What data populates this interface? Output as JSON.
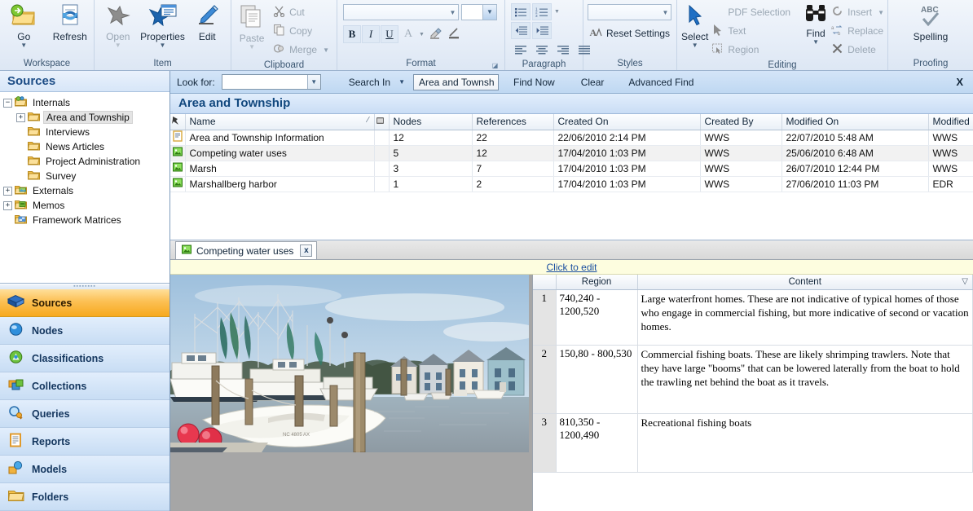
{
  "ribbon": {
    "groups": [
      {
        "name": "Workspace",
        "label": "Workspace",
        "buttons": [
          {
            "label": "Go",
            "icon": "folder-go-icon",
            "caret": true,
            "disabled": false
          },
          {
            "label": "Refresh",
            "icon": "refresh-icon",
            "caret": false,
            "disabled": false
          }
        ]
      },
      {
        "name": "Item",
        "label": "Item",
        "buttons": [
          {
            "label": "Open",
            "icon": "open-item-icon",
            "caret": true,
            "disabled": true
          },
          {
            "label": "Properties",
            "icon": "properties-icon",
            "caret": true,
            "disabled": false
          },
          {
            "label": "Edit",
            "icon": "edit-pencil-icon",
            "caret": false,
            "disabled": false
          }
        ]
      },
      {
        "name": "Clipboard",
        "label": "Clipboard",
        "big": {
          "label": "Paste",
          "icon": "paste-icon",
          "caret": true,
          "disabled": true
        },
        "items": [
          {
            "label": "Cut",
            "icon": "scissors-icon",
            "disabled": true
          },
          {
            "label": "Copy",
            "icon": "copy-icon",
            "disabled": true
          },
          {
            "label": "Merge",
            "icon": "merge-icon",
            "disabled": true,
            "caret": true
          }
        ]
      },
      {
        "name": "Format",
        "label": "Format"
      },
      {
        "name": "Paragraph",
        "label": "Paragraph"
      },
      {
        "name": "Styles",
        "label": "Styles"
      },
      {
        "name": "Editing",
        "label": "Editing"
      },
      {
        "name": "Proofing",
        "label": "Proofing"
      }
    ],
    "format": {
      "font_name_value": "",
      "font_size_value": "",
      "bold_label": "B",
      "italic_label": "I",
      "underline_label": "U",
      "font_color_label": "A",
      "highlight_label": "highlight-icon",
      "text_rule_label": "text-line-icon"
    },
    "styles": {
      "reset_label": "Reset Settings",
      "style_combo_value": ""
    },
    "editing": {
      "select_label": "Select",
      "pdf_selection_label": "PDF Selection",
      "text_label": "Text",
      "region_label": "Region",
      "find_label": "Find",
      "insert_label": "Insert",
      "replace_label": "Replace",
      "delete_label": "Delete"
    },
    "proofing": {
      "spelling_label": "Spelling"
    }
  },
  "sidebar": {
    "title": "Sources",
    "tree": [
      {
        "label": "Internals",
        "depth": 0,
        "expander": "minus",
        "icon": "internals-folder-icon",
        "selected": false
      },
      {
        "label": "Area and Township",
        "depth": 1,
        "expander": "plus",
        "icon": "folder-icon",
        "selected": true
      },
      {
        "label": "Interviews",
        "depth": 1,
        "expander": "none",
        "icon": "folder-icon",
        "selected": false
      },
      {
        "label": "News Articles",
        "depth": 1,
        "expander": "none",
        "icon": "folder-icon",
        "selected": false
      },
      {
        "label": "Project Administration",
        "depth": 1,
        "expander": "none",
        "icon": "folder-icon",
        "selected": false
      },
      {
        "label": "Survey",
        "depth": 1,
        "expander": "none",
        "icon": "folder-icon",
        "selected": false
      },
      {
        "label": "Externals",
        "depth": 0,
        "expander": "plus",
        "icon": "externals-folder-icon",
        "selected": false
      },
      {
        "label": "Memos",
        "depth": 0,
        "expander": "plus",
        "icon": "memos-folder-icon",
        "selected": false
      },
      {
        "label": "Framework Matrices",
        "depth": 0,
        "expander": "none",
        "icon": "framework-matrices-icon",
        "selected": false
      }
    ],
    "nav": [
      {
        "label": "Sources",
        "icon": "sources-book-icon",
        "active": true
      },
      {
        "label": "Nodes",
        "icon": "nodes-circle-icon",
        "active": false
      },
      {
        "label": "Classifications",
        "icon": "classifications-icon",
        "active": false
      },
      {
        "label": "Collections",
        "icon": "collections-icon",
        "active": false
      },
      {
        "label": "Queries",
        "icon": "queries-magnifier-icon",
        "active": false
      },
      {
        "label": "Reports",
        "icon": "reports-icon",
        "active": false
      },
      {
        "label": "Models",
        "icon": "models-icon",
        "active": false
      },
      {
        "label": "Folders",
        "icon": "folders-icon",
        "active": false
      }
    ]
  },
  "findbar": {
    "look_for_label": "Look for:",
    "look_for_value": "",
    "search_in_label": "Search In",
    "scope_value": "Area and Townsh",
    "find_now_label": "Find Now",
    "clear_label": "Clear",
    "advanced_find_label": "Advanced Find",
    "close_label": "X"
  },
  "list": {
    "header_title": "Area and Township",
    "columns": [
      "Name",
      "Nodes",
      "References",
      "Created On",
      "Created By",
      "Modified On",
      "Modified By"
    ],
    "rows": [
      {
        "icon": "document-source-icon",
        "name": "Area and Township Information",
        "nodes": "12",
        "references": "22",
        "created_on": "22/06/2010 2:14 PM",
        "created_by": "WWS",
        "modified_on": "22/07/2010 5:48 AM",
        "modified_by": "WWS"
      },
      {
        "icon": "picture-source-icon",
        "name": "Competing water uses",
        "nodes": "5",
        "references": "12",
        "created_on": "17/04/2010 1:03 PM",
        "created_by": "WWS",
        "modified_on": "25/06/2010 6:48 AM",
        "modified_by": "WWS"
      },
      {
        "icon": "picture-source-icon",
        "name": "Marsh",
        "nodes": "3",
        "references": "7",
        "created_on": "17/04/2010 1:03 PM",
        "created_by": "WWS",
        "modified_on": "26/07/2010 12:44 PM",
        "modified_by": "WWS"
      },
      {
        "icon": "picture-source-icon",
        "name": "Marshallberg harbor",
        "nodes": "1",
        "references": "2",
        "created_on": "17/04/2010 1:03 PM",
        "created_by": "WWS",
        "modified_on": "27/06/2010 11:03 PM",
        "modified_by": "EDR"
      }
    ]
  },
  "detail": {
    "tab_label": "Competing water uses",
    "tab_icon": "picture-source-icon",
    "tab_close_label": "x",
    "edit_hint_label": "Click to edit",
    "region_columns": [
      "Region",
      "Content"
    ],
    "regions": [
      {
        "num": "1",
        "region": "740,240 - 1200,520",
        "content": "Large waterfront homes. These are not indicative of typical homes of those who engage in commercial fishing, but more indicative of second or vacation homes."
      },
      {
        "num": "2",
        "region": "150,80 - 800,530",
        "content": "Commercial fishing boats. These are likely shrimping trawlers. Note that they have large \"booms\" that can be lowered laterally from the boat to hold the trawling net behind the boat as it travels."
      },
      {
        "num": "3",
        "region": "810,350 - 1200,490",
        "content": "Recreational fishing boats"
      }
    ],
    "photo_alt": "marshallberg-harbor-photo"
  },
  "colors": {
    "accent": "#1d4d86",
    "active_nav": "#f7a91e",
    "hint_bg": "#fdfddf",
    "link": "#1a4fa0"
  }
}
